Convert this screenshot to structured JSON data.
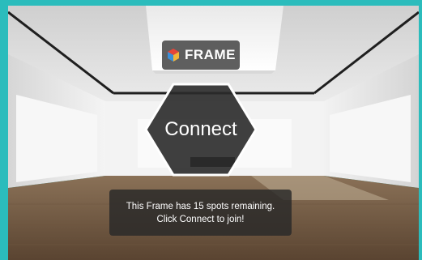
{
  "app": {
    "logo_text": "FRAME",
    "logo_icon": "frame-cube-icon"
  },
  "connect": {
    "label": "Connect"
  },
  "message": {
    "line1": "This Frame has 15 spots remaining.",
    "line2": "Click Connect to join!"
  },
  "colors": {
    "border": "#2bbcbc",
    "overlay": "#3c3c3c",
    "hexagon_fill": "#2a2a2a",
    "hexagon_stroke": "#ffffff",
    "logo_red": "#e6453a",
    "logo_blue": "#3b8fd9",
    "logo_yellow": "#f2b53a"
  }
}
